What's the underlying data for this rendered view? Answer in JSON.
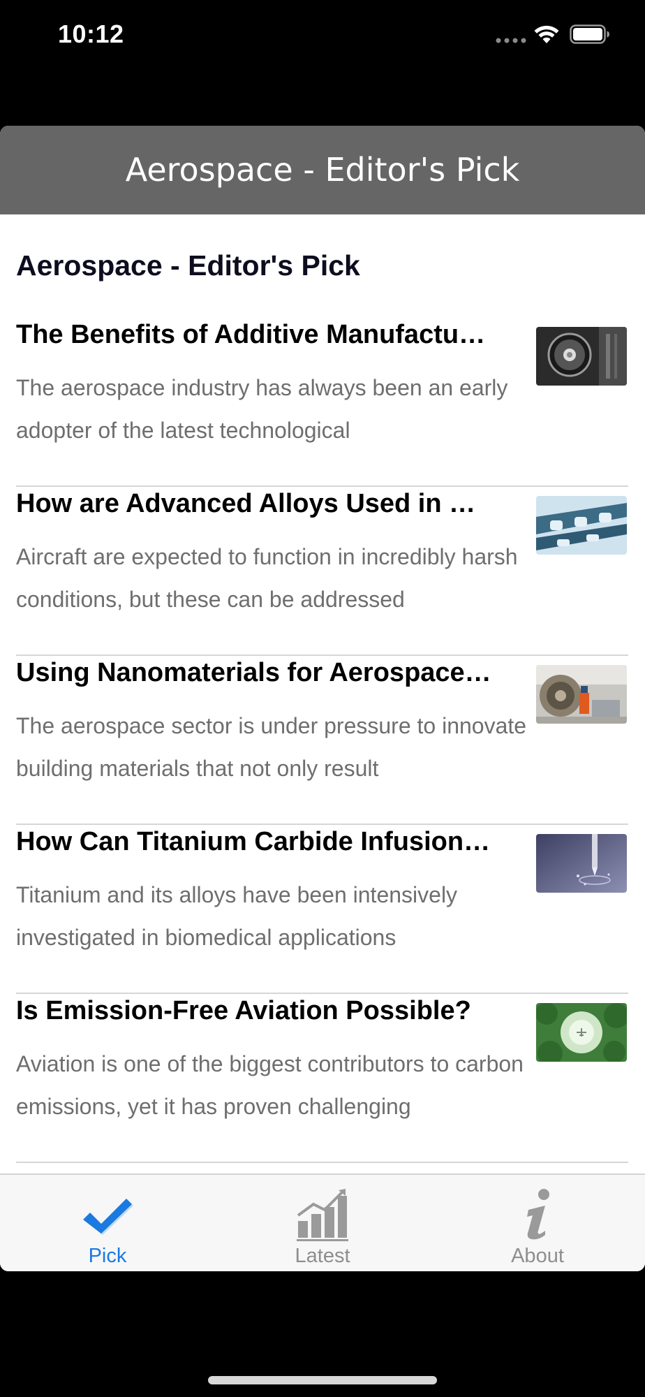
{
  "status_bar": {
    "time": "10:12",
    "icons": [
      "signal-dots-icon",
      "wifi-icon",
      "battery-icon"
    ]
  },
  "nav_bar": {
    "title": "Aerospace - Editor's Pick"
  },
  "section": {
    "title": "Aerospace - Editor's Pick"
  },
  "articles": [
    {
      "title": "The Benefits of Additive Manufactu…",
      "summary": "The aerospace industry has always been an early adopter of the latest technological",
      "thumbnail": "jet-engine-image"
    },
    {
      "title": "How are Advanced Alloys Used in …",
      "summary": "Aircraft are expected to function in incredibly harsh conditions, but these can be addressed",
      "thumbnail": "aircraft-frame-image"
    },
    {
      "title": "Using Nanomaterials for Aerospace…",
      "summary": "The aerospace sector is under pressure to innovate building materials that not only result",
      "thumbnail": "engine-maintenance-image"
    },
    {
      "title": "How Can Titanium Carbide Infusion…",
      "summary": "Titanium and its alloys have been intensively investigated in biomedical applications",
      "thumbnail": "drill-bit-image"
    },
    {
      "title": "Is Emission-Free Aviation Possible?",
      "summary": "Aviation is one of the biggest contributors to carbon emissions, yet it has proven challenging",
      "thumbnail": "plane-through-trees-image"
    }
  ],
  "tab_bar": {
    "tabs": [
      {
        "label": "Pick",
        "icon": "checkmark-icon",
        "active": true
      },
      {
        "label": "Latest",
        "icon": "chart-icon",
        "active": false
      },
      {
        "label": "About",
        "icon": "info-icon",
        "active": false
      }
    ]
  },
  "colors": {
    "nav_background": "#666666",
    "active_tint": "#1a7ae0",
    "inactive_tint": "#8e8e8e"
  }
}
